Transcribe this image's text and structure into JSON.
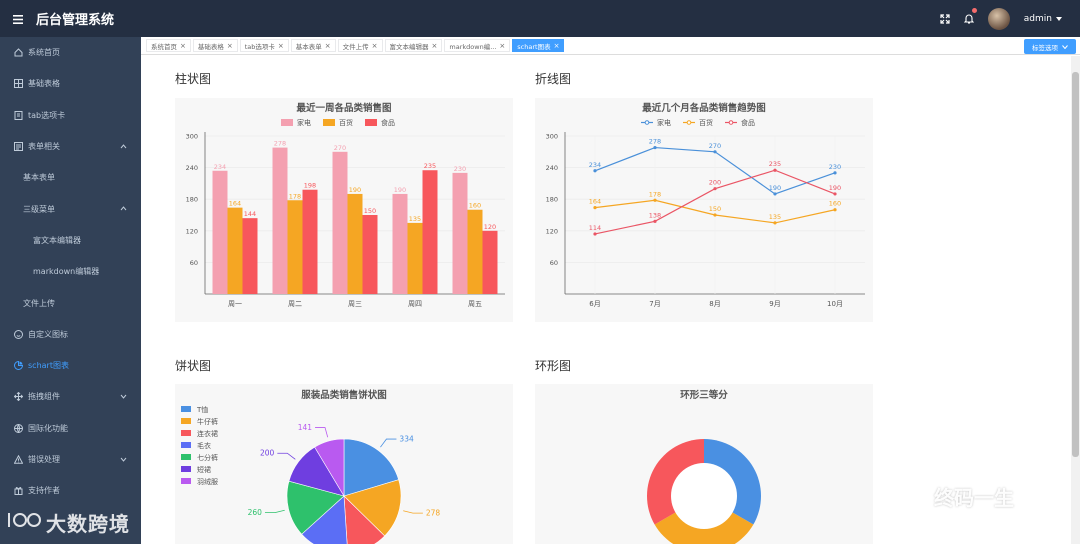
{
  "header": {
    "title": "后台管理系统",
    "username": "admin"
  },
  "sidebar": {
    "items": [
      {
        "label": "系统首页",
        "icon": "home-icon"
      },
      {
        "label": "基础表格",
        "icon": "table-icon"
      },
      {
        "label": "tab选项卡",
        "icon": "tab-icon"
      },
      {
        "label": "表单相关",
        "icon": "form-icon"
      },
      {
        "label": "基本表单"
      },
      {
        "label": "三级菜单"
      },
      {
        "label": "富文本编辑器"
      },
      {
        "label": "markdown编辑器"
      },
      {
        "label": "文件上传"
      },
      {
        "label": "自定义图标",
        "icon": "smile-icon"
      },
      {
        "label": "schart图表",
        "icon": "chart-icon"
      },
      {
        "label": "拖拽组件",
        "icon": "drag-icon"
      },
      {
        "label": "国际化功能",
        "icon": "globe-icon"
      },
      {
        "label": "错误处理",
        "icon": "warning-icon"
      },
      {
        "label": "支持作者",
        "icon": "gift-icon"
      }
    ]
  },
  "tags": [
    {
      "label": "系统首页"
    },
    {
      "label": "基础表格"
    },
    {
      "label": "tab选项卡"
    },
    {
      "label": "基本表单"
    },
    {
      "label": "文件上传"
    },
    {
      "label": "富文本编辑器"
    },
    {
      "label": "markdown编..."
    },
    {
      "label": "schart图表"
    }
  ],
  "tag_options_label": "标签选项",
  "sections": {
    "bar": "柱状图",
    "line": "折线图",
    "pie": "饼状图",
    "donut": "环形图"
  },
  "watermarks": {
    "left": "大数跨境",
    "right": "终码一生"
  },
  "colors": {
    "header_bg": "#242f42",
    "sidebar_bg": "#324157",
    "accent": "#409eff"
  },
  "chart_data": [
    {
      "type": "bar",
      "title": "最近一周各品类销售图",
      "categories": [
        "周一",
        "周二",
        "周三",
        "周四",
        "周五"
      ],
      "series": [
        {
          "name": "家电",
          "values": [
            234,
            278,
            270,
            190,
            230
          ],
          "color": "#f4a0b0"
        },
        {
          "name": "百货",
          "values": [
            164,
            178,
            190,
            135,
            160
          ],
          "color": "#f5a623"
        },
        {
          "name": "食品",
          "values": [
            144,
            198,
            150,
            235,
            120
          ],
          "color": "#f7575c"
        }
      ],
      "yticks": [
        60,
        120,
        180,
        240,
        300
      ],
      "ylim": [
        0,
        300
      ],
      "legend": "top-center"
    },
    {
      "type": "line",
      "title": "最近几个月各品类销售趋势图",
      "categories": [
        "6月",
        "7月",
        "8月",
        "9月",
        "10月"
      ],
      "series": [
        {
          "name": "家电",
          "values": [
            234,
            278,
            270,
            190,
            230
          ],
          "color": "#4a90d9"
        },
        {
          "name": "百货",
          "values": [
            164,
            178,
            150,
            135,
            160
          ],
          "color": "#f5a623"
        },
        {
          "name": "食品",
          "values": [
            114,
            138,
            200,
            235,
            190
          ],
          "color": "#ea5565"
        }
      ],
      "yticks": [
        60,
        120,
        180,
        240,
        300
      ],
      "ylim": [
        0,
        300
      ],
      "legend": "top-center"
    },
    {
      "type": "pie",
      "title": "服装品类销售饼状图",
      "slices": [
        {
          "name": "T恤",
          "value": 334,
          "color": "#4a90e2"
        },
        {
          "name": "牛仔裤",
          "value": 278,
          "color": "#f5a623"
        },
        {
          "name": "连衣裙",
          "value": 190,
          "color": "#f7575c"
        },
        {
          "name": "毛衣",
          "value": 235,
          "color": "#5b6ef5"
        },
        {
          "name": "七分裤",
          "value": 260,
          "color": "#2ec16c"
        },
        {
          "name": "短裙",
          "value": 200,
          "color": "#6f3ee0"
        },
        {
          "name": "羽绒服",
          "value": 141,
          "color": "#b95af0"
        }
      ],
      "legend": "top-left"
    },
    {
      "type": "pie",
      "title": "环形三等分",
      "slices": [
        {
          "value": 1,
          "color": "#4a90e2"
        },
        {
          "value": 1,
          "color": "#f5a623"
        },
        {
          "value": 1,
          "color": "#f7575c"
        }
      ]
    }
  ]
}
